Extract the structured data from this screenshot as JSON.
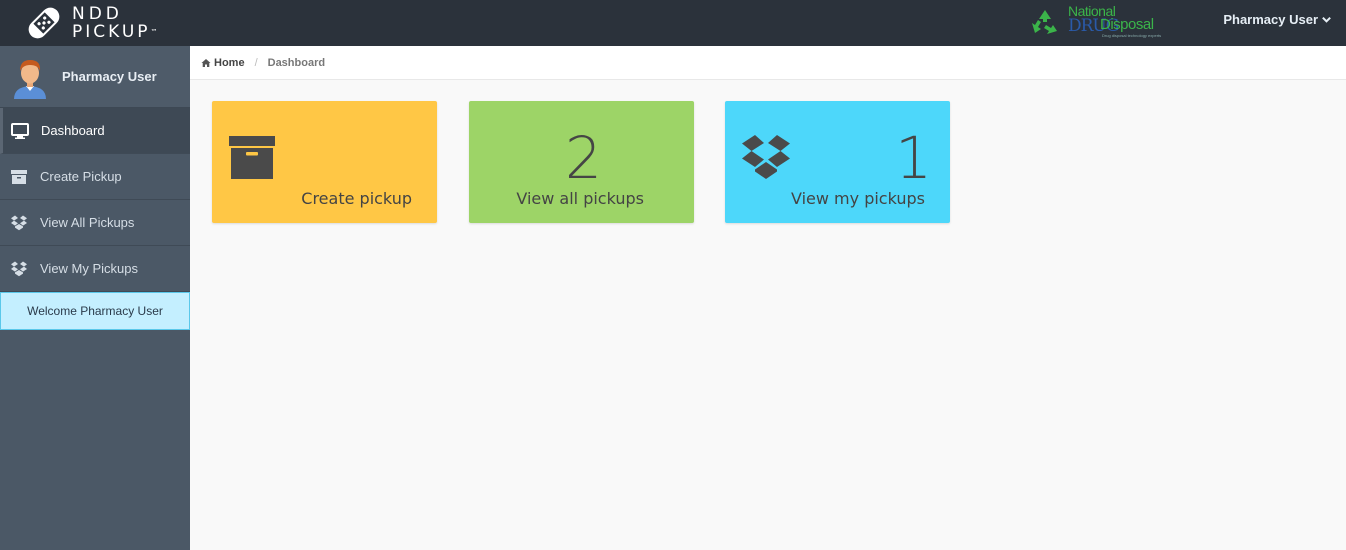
{
  "brand": {
    "line1": "NDD",
    "line2": "PICKUP",
    "tm": "™"
  },
  "partner_logo": {
    "national": "National",
    "drug": "DRUG",
    "disposal": "Disposal",
    "tagline": "Drug disposal technology experts"
  },
  "header": {
    "user_label": "Pharmacy User"
  },
  "sidebar": {
    "profile_name": "Pharmacy User",
    "items": [
      {
        "label": "Dashboard",
        "icon": "monitor-icon",
        "active": true
      },
      {
        "label": "Create Pickup",
        "icon": "archive-icon"
      },
      {
        "label": "View All Pickups",
        "icon": "dropbox-icon"
      },
      {
        "label": "View My Pickups",
        "icon": "dropbox-icon"
      }
    ],
    "welcome": "Welcome Pharmacy User"
  },
  "breadcrumb": {
    "home": "Home",
    "current": "Dashboard"
  },
  "tiles": [
    {
      "label": "Create pickup",
      "count": "",
      "color": "#ffc745",
      "icon": "archive-icon"
    },
    {
      "label": "View all pickups",
      "count": "2",
      "color": "#9dd467",
      "icon": ""
    },
    {
      "label": "View my pickups",
      "count": "1",
      "color": "#4dd7fa",
      "icon": "dropbox-icon"
    }
  ],
  "colors": {
    "topbar": "#2b323b",
    "sidebar": "#4b5866",
    "welcome_bg": "#c4efff",
    "content_bg": "#f9f9f9"
  }
}
